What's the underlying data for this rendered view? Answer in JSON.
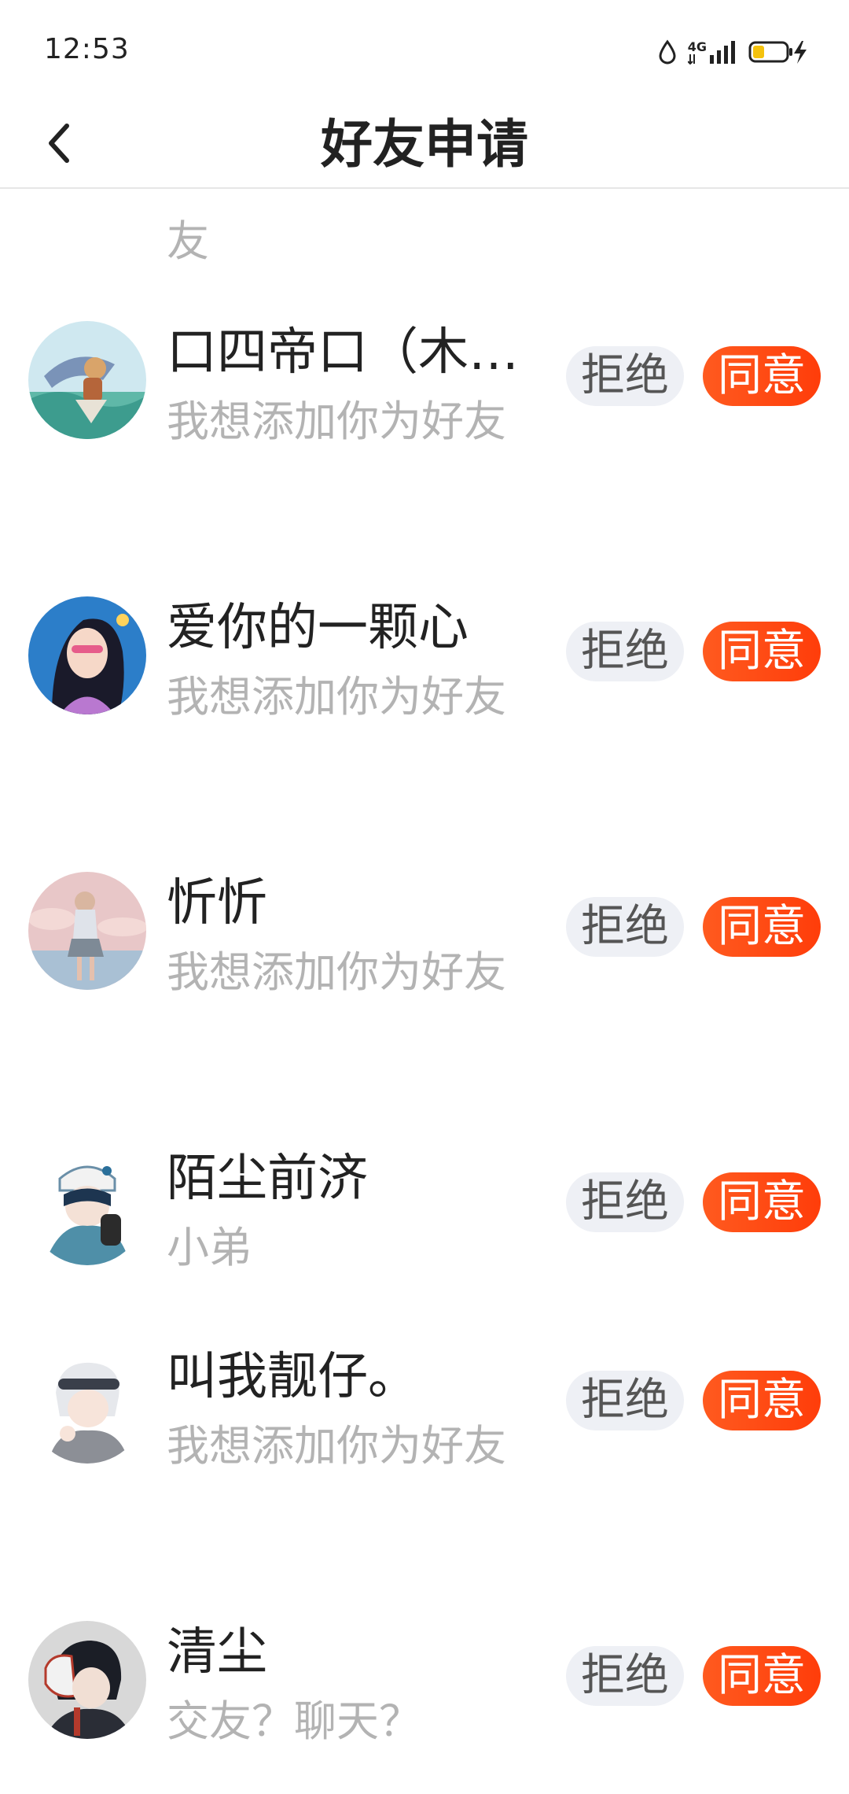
{
  "status_bar": {
    "time": "12:53",
    "network": "4G",
    "icons": [
      "water-drop-icon",
      "signal-4g-icon",
      "battery-charging-icon"
    ]
  },
  "nav": {
    "title": "好友申请",
    "back_icon": "chevron-left-icon"
  },
  "list": {
    "partial_top_text": "友",
    "items": [
      {
        "name": "口四帝口（木…",
        "message": "我想添加你为好友",
        "reject_label": "拒绝",
        "accept_label": "同意"
      },
      {
        "name": "爱你的一颗心",
        "message": "我想添加你为好友",
        "reject_label": "拒绝",
        "accept_label": "同意"
      },
      {
        "name": "忻忻",
        "message": "我想添加你为好友",
        "reject_label": "拒绝",
        "accept_label": "同意"
      },
      {
        "name": "陌尘前济",
        "message": "小弟",
        "reject_label": "拒绝",
        "accept_label": "同意"
      },
      {
        "name": "叫我靓仔。",
        "message": "我想添加你为好友",
        "reject_label": "拒绝",
        "accept_label": "同意"
      },
      {
        "name": "清尘",
        "message": "交友？聊天？",
        "reject_label": "拒绝",
        "accept_label": "同意"
      }
    ]
  },
  "colors": {
    "accept_bg": "#ff4f14",
    "reject_bg": "#eef0f5",
    "secondary_text": "#b3b3b3",
    "primary_text": "#222222"
  }
}
